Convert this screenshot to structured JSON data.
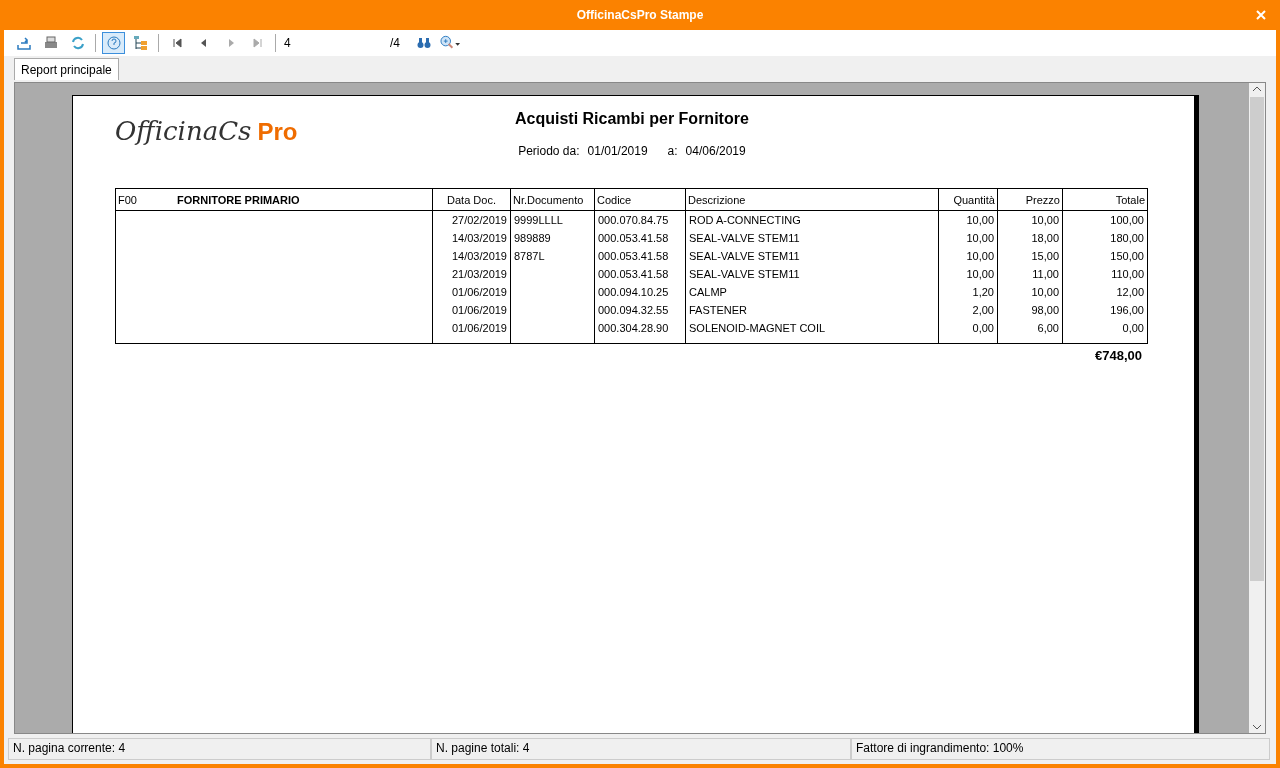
{
  "window": {
    "title": "OfficinaCsPro Stampe"
  },
  "toolbar": {
    "help_on": true,
    "page_value": "4",
    "page_total": "/4"
  },
  "tabs": [
    {
      "label": "Report principale",
      "selected": true
    }
  ],
  "report": {
    "logo_script": "OfficinaCs",
    "logo_accent": "Pro",
    "title": "Acquisti Ricambi per Fornitore",
    "period_label": "Periodo da:",
    "period_from": "01/01/2019",
    "period_to_label": "a:",
    "period_to": "04/06/2019",
    "supplier_code": "F00",
    "supplier_name": "FORNITORE PRIMARIO",
    "columns": [
      "Data Doc.",
      "Nr.Documento",
      "Codice",
      "Descrizione",
      "Quantità",
      "Prezzo",
      "Totale"
    ],
    "rows": [
      [
        "27/02/2019",
        "9999LLLL",
        "000.070.84.75",
        "ROD A-CONNECTING",
        "10,00",
        "10,00",
        "100,00"
      ],
      [
        "14/03/2019",
        "989889",
        "000.053.41.58",
        "SEAL-VALVE STEM11",
        "10,00",
        "18,00",
        "180,00"
      ],
      [
        "14/03/2019",
        "8787L",
        "000.053.41.58",
        "SEAL-VALVE STEM11",
        "10,00",
        "15,00",
        "150,00"
      ],
      [
        "21/03/2019",
        "",
        "000.053.41.58",
        "SEAL-VALVE STEM11",
        "10,00",
        "11,00",
        "110,00"
      ],
      [
        "01/06/2019",
        "",
        "000.094.10.25",
        "CALMP",
        "1,20",
        "10,00",
        "12,00"
      ],
      [
        "01/06/2019",
        "",
        "000.094.32.55",
        "FASTENER",
        "2,00",
        "98,00",
        "196,00"
      ],
      [
        "01/06/2019",
        "",
        "000.304.28.90",
        "SOLENOID-MAGNET COIL",
        "0,00",
        "6,00",
        "0,00"
      ]
    ],
    "total": "€748,00"
  },
  "status_bar": [
    "N. pagina corrente: 4",
    "N. pagine totali: 4",
    "Fattore di ingrandimento: 100%"
  ]
}
